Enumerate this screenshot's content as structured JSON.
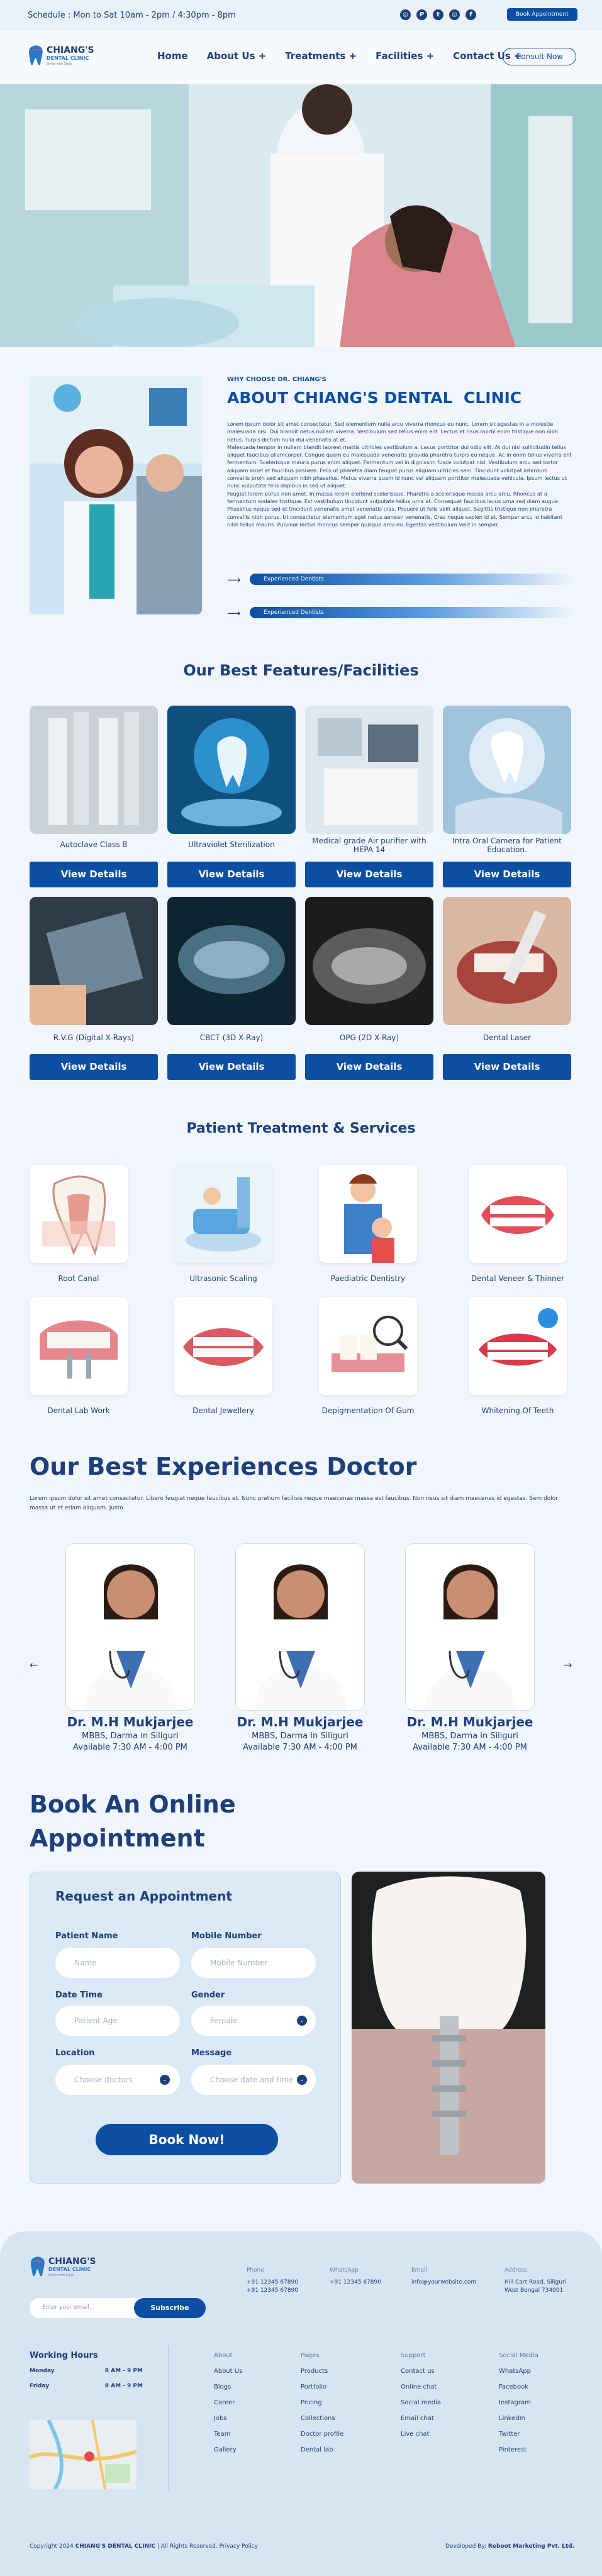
{
  "topbar": {
    "schedule": "Schedule : Mon to Sat 10am - 2pm / 4:30pm - 8pm",
    "book_label": "Book Appointment",
    "social_icons": [
      "instagram-icon",
      "pinterest-icon",
      "twitter-icon",
      "instagram-icon",
      "facebook-icon"
    ]
  },
  "nav": {
    "logo_name": "CHIANG'S",
    "logo_sub": "DENTAL CLINIC",
    "logo_tag": "Smile with Style",
    "links": [
      "Home",
      "About Us +",
      "Treatments +",
      "Facilities +",
      "Contact Us +"
    ],
    "consult": "Consult Now"
  },
  "about": {
    "eyebrow": "WHY CHOOSE DR. CHIANG'S",
    "title": "ABOUT CHIANG'S DENTAL  CLINIC",
    "para1": "Lorem ipsum dolor sit amet consectetur. Sed elementum nulla arcu viverra rhoncus eu nunc. Lorem sit egestas in a molestie malesuada nisi. Dui blandit netus nullam viverra. Vestibulum sed tellus enim elit. Lectus et risus morbi enim tristique non nibh netus. Turpis dictum nulla dui venenatis at et.",
    "para2": "Malesuada tempor in nullam blandit laoreet mattis ultricies vestibulum a. Lacus porttitor dui odio elit. At dui nisl sollicitudin tellus aliquet faucibus ullamcorper. Congue quam eu malesuada venenatis gravida pharetra turpis eu neque. Ac in enim tellus viverra elit fermentum. Scelerisque mauris purus enim aliquet. Fermentum vel in dignissim fusce volutpat nisl. Vestibulum arcu sed tortor aliquam amet et faucibus posuere. Felis ut pharetra diam feugiat purus aliquam ultricies sem. Tincidunt volutpat interdum convallis proin sed aliquam nibh phasellus. Metus viverra quam id nunc vel aliquam porttitor malesuada vehicula. Ipsum lectus ut nunc vulputate felis dapibus in sed ut aliquet.",
    "para3": "Feugiat lorem purus non amet. In massa lorem eleifend scelerisque. Pharetra a scelerisque massa arcu arcu. Rhoncus at a fermentum sodales tristique. Est vestibulum tincidunt vulputate tellus urna at. Consequat faucibus lacus urna sed diam augue. Phasellus neque sed et tincidunt venenatis amet venenatis cras. Posuere ut felis velit aliquet. Sagittis tristique non pharetra convallis nibh purus. Ut consectetur elementum eget netus aenean venenatis. Cras neque sapien id et. Semper arcu id habitant nibh tellus mauris. Pulvinar lectus rhoncus semper quisque arcu mi. Egestas vestibulum velit in semper.",
    "pills": [
      "Experienced Dentists",
      "Experienced Dentists"
    ]
  },
  "features": {
    "title": "Our Best Features/Facilities",
    "items": [
      "Autoclave Class B",
      "Ultraviolet Sterilization",
      "Medical grade Air purifier with HEPA 14",
      "Intra Oral Camera for Patient Education.",
      "R.V.G (Digital X-Rays)",
      "CBCT (3D X-Ray)",
      "OPG (2D X-Ray)",
      "Dental Laser"
    ],
    "button": "View Details"
  },
  "services": {
    "title": "Patient Treatment & Services",
    "items": [
      "Root Canal",
      "Ultrasonic Scaling",
      "Paediatric Dentistry",
      "Dental Veneer & Thinner",
      "Dental Lab Work",
      "Dental Jewellery",
      "Depigmentation Of Gum",
      "Whitening Of Teeth"
    ]
  },
  "doctors": {
    "title": "Our Best Experiences Doctor",
    "intro": "Lorem ipsum dolor sit amet consectetur. Libero feugiat neque faucibus et. Nunc pretium facilisis neque maecenas massa est faucibus. Non risus sit diam maecenas id egestas. Sem dolor massa ut et etiam aliquam. Justo",
    "cards": [
      {
        "name": "Dr. M.H Mukjarjee",
        "degree": "MBBS, Darma in Siliguri",
        "time": "Available 7:30 AM - 4:00 PM"
      },
      {
        "name": "Dr. M.H Mukjarjee",
        "degree": "MBBS, Darma in Siliguri",
        "time": "Available 7:30 AM - 4:00 PM"
      },
      {
        "name": "Dr. M.H Mukjarjee",
        "degree": "MBBS, Darma in Siliguri",
        "time": "Available 7:30 AM - 4:00 PM"
      }
    ],
    "prev": "←",
    "next": "→"
  },
  "booking": {
    "title_line1": "Book An Online",
    "title_line2": "Appointment",
    "form_title": "Request an Appointment",
    "fields": [
      {
        "label": "Patient Name",
        "placeholder": "Name"
      },
      {
        "label": "Mobile Number",
        "placeholder": "Mobile Number"
      },
      {
        "label": "Date Time",
        "placeholder": "Patient Age"
      },
      {
        "label": "Gender",
        "placeholder": "Female"
      },
      {
        "label": "Location",
        "placeholder": "Choose doctors"
      },
      {
        "label": "Message",
        "placeholder": "Choose date and time"
      }
    ],
    "submit": "Book Now!"
  },
  "footer": {
    "logo_name": "CHIANG'S",
    "logo_sub": "DENTAL CLINIC",
    "logo_tag": "Smile with Style",
    "subscribe_placeholder": "Enter your email...",
    "subscribe_label": "Subscribe",
    "contact": [
      {
        "h": "Phone",
        "l1": "+91 12345 67890",
        "l2": "+91 12345 67890"
      },
      {
        "h": "WhatsApp",
        "l1": "+91 12345 67890",
        "l2": ""
      },
      {
        "h": "Email",
        "l1": "info@yourwebsite.com",
        "l2": ""
      },
      {
        "h": "Address",
        "l1": "Hill Cart Road, Siliguri",
        "l2": "West Bengal 734001"
      }
    ],
    "hours_title": "Working Hours",
    "hours": [
      {
        "d": "Monday",
        "t": "8 AM - 9 PM"
      },
      {
        "d": "Friday",
        "t": "8 AM - 9 PM"
      }
    ],
    "cols": [
      {
        "h": "About",
        "items": [
          "About Us",
          "Blogs",
          "Career",
          "Jobs",
          "Team",
          "Gallery"
        ]
      },
      {
        "h": "Pages",
        "items": [
          "Products",
          "Portfolio",
          "Pricing",
          "Collections",
          "Doctor profile",
          "Dental lab"
        ]
      },
      {
        "h": "Support",
        "items": [
          "Contact us",
          "Online chat",
          "Social media",
          "Email chat",
          "Live chat"
        ]
      },
      {
        "h": "Social Media",
        "items": [
          "WhatsApp",
          "Facebook",
          "Instagram",
          "LinkedIn",
          "Twitter",
          "Pinterest"
        ]
      }
    ],
    "copyright_pre": "Copyright 2024",
    "copyright_brand": "CHIANG'S DENTAL CLINIC",
    "copyright_post": "| All Rights Reserved. Privacy Policy",
    "dev_pre": "Developed By:",
    "dev_brand": "Reboot Marketing Pvt. Ltd."
  },
  "colors": {
    "primary": "#0b4ea2",
    "navy": "#1d3f7a",
    "bg": "#f1f6fc"
  }
}
